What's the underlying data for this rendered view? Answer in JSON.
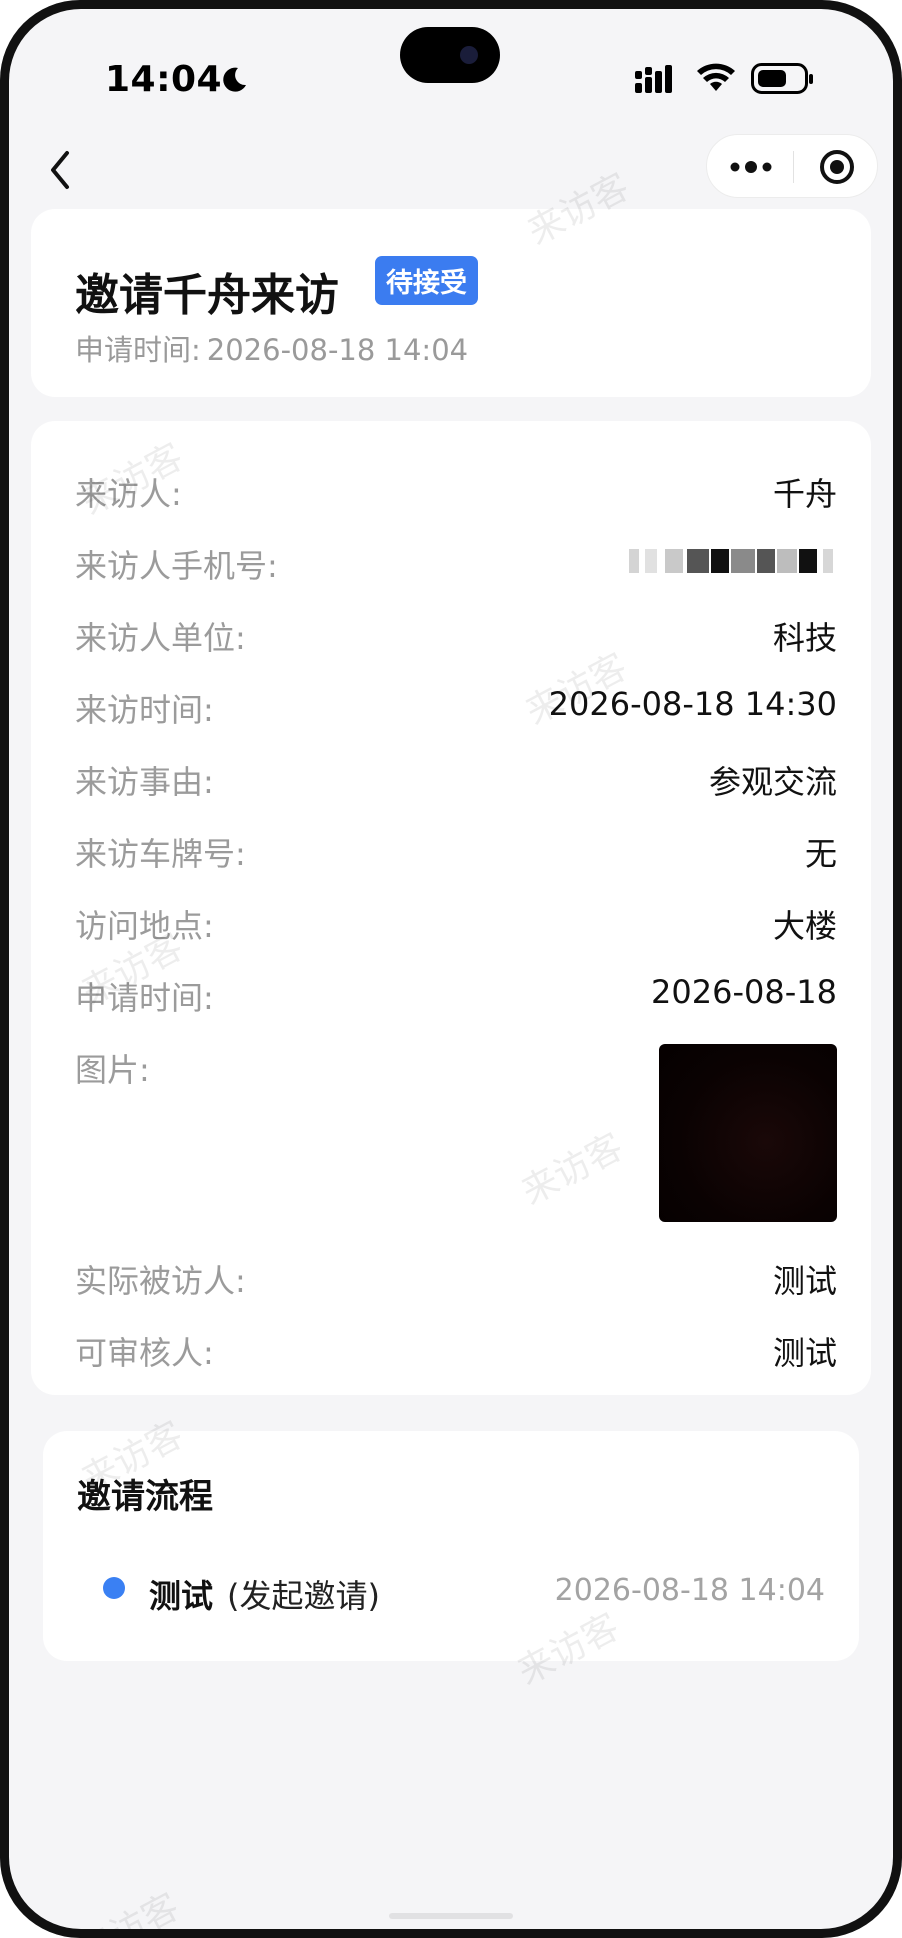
{
  "status_bar": {
    "time": "14:04"
  },
  "nav": {
    "back_icon": "chevron-left-icon",
    "more_icon": "more-dots-icon",
    "close_icon": "target-circle-icon"
  },
  "header": {
    "title": "邀请千舟来访",
    "status_badge": "待接受",
    "apply_time_label": "申请时间:",
    "apply_time_value": "2026-08-18 14:04"
  },
  "details": [
    {
      "label": "来访人:",
      "value": "千舟"
    },
    {
      "label": "来访人手机号:",
      "value": ""
    },
    {
      "label": "来访人单位:",
      "value": "科技"
    },
    {
      "label": "来访时间:",
      "value": "2026-08-18 14:30"
    },
    {
      "label": "来访事由:",
      "value": "参观交流"
    },
    {
      "label": "来访车牌号:",
      "value": "无"
    },
    {
      "label": "访问地点:",
      "value": "大楼"
    },
    {
      "label": "申请时间:",
      "value": "2026-08-18"
    },
    {
      "label": "图片:",
      "value": ""
    },
    {
      "label": "实际被访人:",
      "value": "测试"
    },
    {
      "label": "可审核人:",
      "value": "测试"
    }
  ],
  "flow": {
    "title": "邀请流程",
    "steps": [
      {
        "name": "测试",
        "action": "(发起邀请)",
        "time": "2026-08-18 14:04"
      }
    ]
  },
  "watermark": "来访客",
  "colors": {
    "accent": "#3b7cf0",
    "background": "#f5f5f7",
    "label_gray": "#9b9b9b"
  }
}
